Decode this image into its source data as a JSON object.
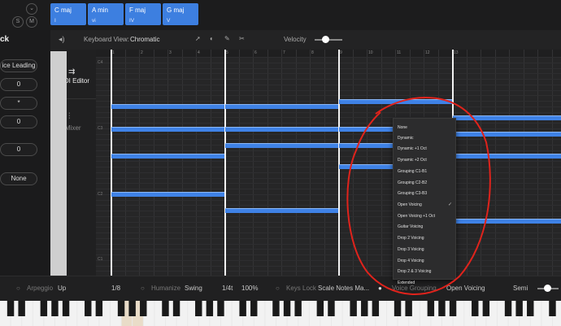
{
  "track": {
    "solo": "S",
    "mute": "M",
    "title_fragment": "ck"
  },
  "chords": [
    {
      "name": "C maj",
      "numeral": "I"
    },
    {
      "name": "A min",
      "numeral": "vi"
    },
    {
      "name": "F maj",
      "numeral": "IV"
    },
    {
      "name": "G maj",
      "numeral": "V"
    }
  ],
  "toolbar": {
    "keyboard_view_label": "Keyboard View:",
    "keyboard_view_value": "Chromatic",
    "velocity_label": "Velocity"
  },
  "left_panel": {
    "voice_leading": "ice Leading",
    "field1": "0",
    "field2": "*",
    "field3": "0",
    "field4": "0",
    "none": "None"
  },
  "sidebar": {
    "midi_editor": "MIDI Editor",
    "mixer": "Mixer"
  },
  "piano_roll": {
    "note_labels": [
      "C4",
      "C3",
      "C2",
      "C1"
    ],
    "measures": [
      "1",
      "2",
      "3",
      "4",
      "5",
      "6",
      "7",
      "8",
      "9",
      "10",
      "11",
      "12",
      "13"
    ]
  },
  "voicing_menu": {
    "items": [
      "None",
      "Dynamic",
      "Dynamic +1 Oct",
      "Dynamic +2 Oct",
      "Grouping C1-B1",
      "Grouping C2-B2",
      "Grouping C3-B3",
      "Open Voicing",
      "Open Voicing +1 Oct",
      "Guitar Voicing",
      "Drop 2 Voicing",
      "Drop 3 Voicing",
      "Drop 4 Voicing",
      "Drop 2 & 3 Voicing",
      "Extended"
    ],
    "selected": "Open Voicing",
    "check": "✓"
  },
  "bottom_bar": {
    "arpeggio_label": "Arpeggio",
    "arpeggio_value": "Up",
    "arpeggio_rate": "1/8",
    "humanize_label": "Humanize",
    "humanize_value": "Swing",
    "humanize_rate": "1/4t",
    "humanize_amount": "100%",
    "keys_lock_label": "Keys Lock",
    "keys_lock_value": "Scale Notes Ma...",
    "voice_grouping_label": "Voice Grouping",
    "voice_grouping_value": "Open Voicing",
    "semi": "Semi"
  },
  "colors": {
    "accent": "#3d7fe0",
    "annotation": "#e0231c"
  }
}
